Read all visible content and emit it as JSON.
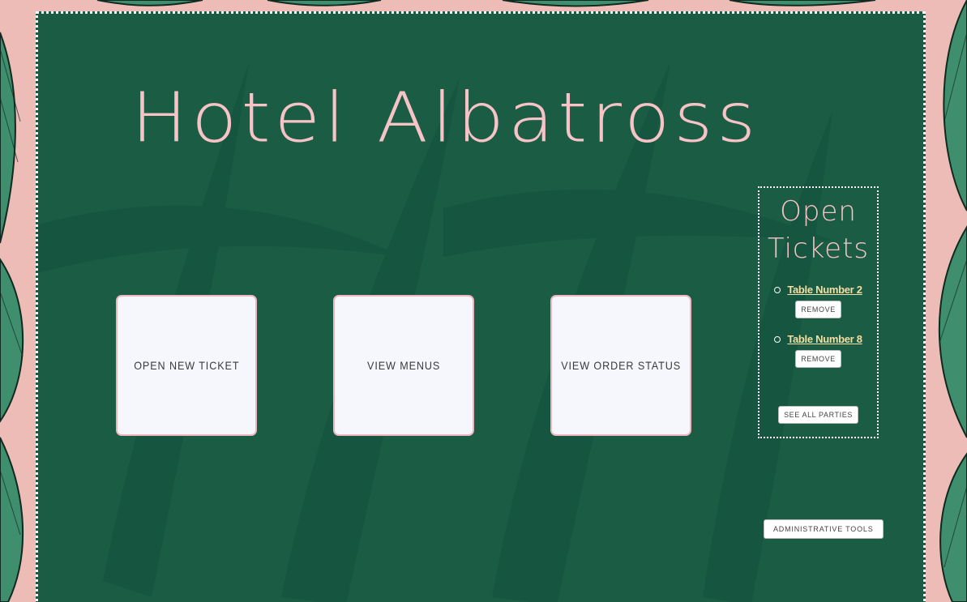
{
  "page": {
    "title": "Hotel Albatross"
  },
  "actions": {
    "open_new_ticket": "OPEN NEW TICKET",
    "view_menus": "VIEW MENUS",
    "view_order_status": "VIEW ORDER STATUS"
  },
  "open_tickets": {
    "title": "Open Tickets",
    "items": [
      {
        "label": "Table Number 2",
        "remove_label": "REMOVE"
      },
      {
        "label": "Table Number 8",
        "remove_label": "REMOVE"
      }
    ],
    "see_all_label": "SEE ALL PARTIES"
  },
  "admin": {
    "label": "ADMINISTRATIVE TOOLS"
  },
  "colors": {
    "border_pink": "#eebcb6",
    "panel_green": "#1b5c45",
    "title_pink": "#f7c3c6",
    "link_gold": "#f3dea3",
    "tile_bg": "#f6f7fd"
  }
}
